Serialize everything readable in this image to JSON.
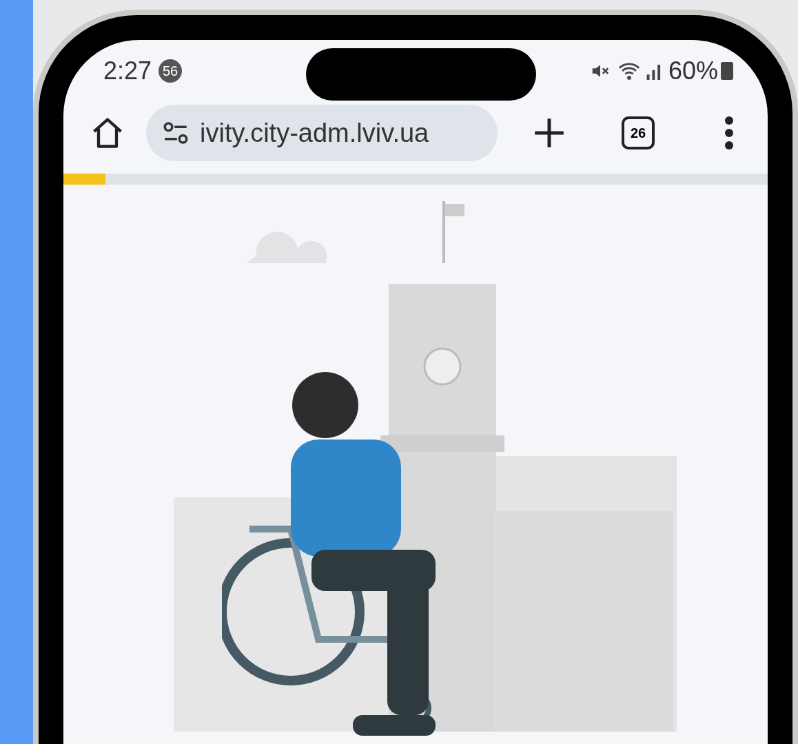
{
  "status_bar": {
    "time": "2:27",
    "notification_count": "56",
    "battery": "60%"
  },
  "browser_toolbar": {
    "url": "ivity.city-adm.lviv.ua",
    "tab_count": "26"
  },
  "page_load": {
    "level": 0.06
  }
}
